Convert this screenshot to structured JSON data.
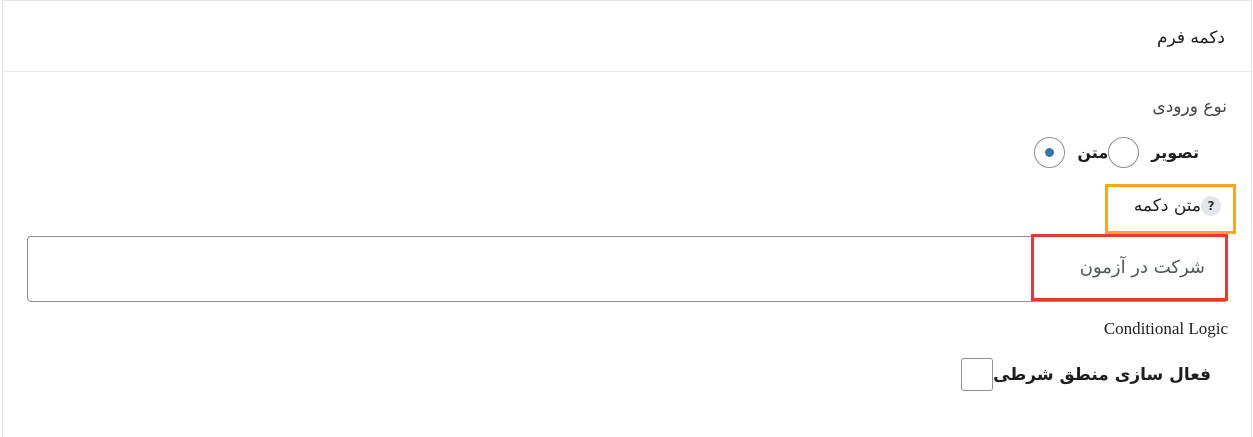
{
  "panel": {
    "title": "دکمه فرم"
  },
  "input_type": {
    "label": "نوع ورودی",
    "options": [
      {
        "label": "متن",
        "checked": true
      },
      {
        "label": "تصویر",
        "checked": false
      }
    ]
  },
  "button_text": {
    "label": "متن دکمه",
    "help_icon": "?",
    "value": "شرکت در آزمون"
  },
  "conditional_logic": {
    "title": "Conditional Logic",
    "checkbox_label": "فعال سازی منطق شرطی",
    "checked": false
  },
  "colors": {
    "radio_accent": "#3b73a8",
    "highlight_orange": "#f5a623",
    "highlight_red": "#e53935"
  }
}
